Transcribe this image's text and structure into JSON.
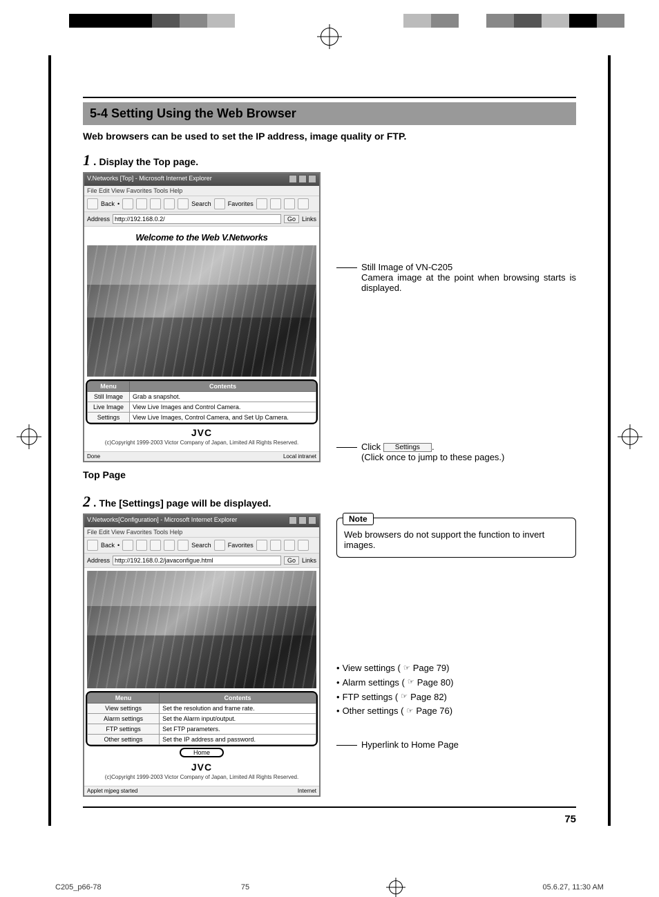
{
  "section_header": "5-4 Setting Using the Web Browser",
  "subtitle": "Web browsers can be used to set the IP address, image quality or FTP.",
  "step1": {
    "num": "1",
    "text": "Display the Top page."
  },
  "step2": {
    "num": "2",
    "text": "The [Settings] page will be displayed."
  },
  "top_caption": "Top Page",
  "annot": {
    "still_title": "Still Image of VN-C205",
    "still_desc": "Camera image at the point when browsing starts is displayed.",
    "click_label": "Click",
    "settings_chip": "Settings",
    "click_period": ".",
    "click_desc": "(Click once to jump to these pages.)",
    "home_link": "Hyperlink to Home Page"
  },
  "note": {
    "label": "Note",
    "text": "Web browsers do not support the function to invert images."
  },
  "bullets": {
    "view": "View settings (",
    "view_page": " Page 79)",
    "alarm": "Alarm settings (",
    "alarm_page": " Page 80)",
    "ftp": "FTP settings (",
    "ftp_page": " Page 82)",
    "other": "Other settings (",
    "other_page": " Page 76)"
  },
  "ie1": {
    "title": "V.Networks [Top] - Microsoft Internet Explorer",
    "menu": "File   Edit   View   Favorites   Tools   Help",
    "back": "Back",
    "search": "Search",
    "favorites": "Favorites",
    "addr_label": "Address",
    "addr": "http://192.168.0.2/",
    "go": "Go",
    "links": "Links",
    "welcome": "Welcome to the Web V.Networks",
    "menu_h": "Menu",
    "contents_h": "Contents",
    "rows": [
      {
        "m": "Still Image",
        "c": "Grab a snapshot."
      },
      {
        "m": "Live Image",
        "c": "View Live Images and Control Camera."
      },
      {
        "m": "Settings",
        "c": "View Live Images, Control Camera, and Set Up Camera."
      }
    ],
    "jvc": "JVC",
    "copyright": "(c)Copyright 1999-2003 Victor Company of Japan, Limited All Rights Reserved.",
    "status_l": "Done",
    "status_r": "Local intranet"
  },
  "ie2": {
    "title": "V.Networks[Configuration] - Microsoft Internet Explorer",
    "menu": "File   Edit   View   Favorites   Tools   Help",
    "back": "Back",
    "search": "Search",
    "favorites": "Favorites",
    "addr_label": "Address",
    "addr": "http://192.168.0.2/javaconfigue.html",
    "go": "Go",
    "links": "Links",
    "menu_h": "Menu",
    "contents_h": "Contents",
    "rows": [
      {
        "m": "View settings",
        "c": "Set the resolution and frame rate."
      },
      {
        "m": "Alarm settings",
        "c": "Set the Alarm input/output."
      },
      {
        "m": "FTP settings",
        "c": "Set FTP parameters."
      },
      {
        "m": "Other settings",
        "c": "Set the IP address and password."
      }
    ],
    "home": "Home",
    "jvc": "JVC",
    "copyright": "(c)Copyright 1999-2003 Victor Company of Japan, Limited All Rights Reserved.",
    "status_l": "Applet mjpeg started",
    "status_r": "Internet"
  },
  "page_num": "75",
  "footer": {
    "left": "C205_p66-78",
    "mid": "75",
    "right": "05.6.27, 11:30 AM"
  }
}
